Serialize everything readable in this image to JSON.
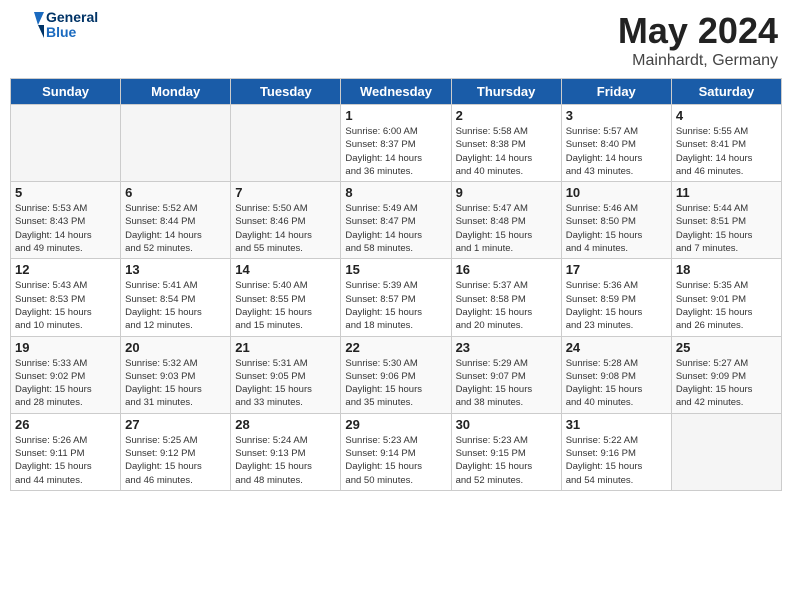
{
  "header": {
    "logo_line1": "General",
    "logo_line2": "Blue",
    "month_year": "May 2024",
    "location": "Mainhardt, Germany"
  },
  "days_of_week": [
    "Sunday",
    "Monday",
    "Tuesday",
    "Wednesday",
    "Thursday",
    "Friday",
    "Saturday"
  ],
  "weeks": [
    [
      {
        "day": "",
        "info": ""
      },
      {
        "day": "",
        "info": ""
      },
      {
        "day": "",
        "info": ""
      },
      {
        "day": "1",
        "info": "Sunrise: 6:00 AM\nSunset: 8:37 PM\nDaylight: 14 hours\nand 36 minutes."
      },
      {
        "day": "2",
        "info": "Sunrise: 5:58 AM\nSunset: 8:38 PM\nDaylight: 14 hours\nand 40 minutes."
      },
      {
        "day": "3",
        "info": "Sunrise: 5:57 AM\nSunset: 8:40 PM\nDaylight: 14 hours\nand 43 minutes."
      },
      {
        "day": "4",
        "info": "Sunrise: 5:55 AM\nSunset: 8:41 PM\nDaylight: 14 hours\nand 46 minutes."
      }
    ],
    [
      {
        "day": "5",
        "info": "Sunrise: 5:53 AM\nSunset: 8:43 PM\nDaylight: 14 hours\nand 49 minutes."
      },
      {
        "day": "6",
        "info": "Sunrise: 5:52 AM\nSunset: 8:44 PM\nDaylight: 14 hours\nand 52 minutes."
      },
      {
        "day": "7",
        "info": "Sunrise: 5:50 AM\nSunset: 8:46 PM\nDaylight: 14 hours\nand 55 minutes."
      },
      {
        "day": "8",
        "info": "Sunrise: 5:49 AM\nSunset: 8:47 PM\nDaylight: 14 hours\nand 58 minutes."
      },
      {
        "day": "9",
        "info": "Sunrise: 5:47 AM\nSunset: 8:48 PM\nDaylight: 15 hours\nand 1 minute."
      },
      {
        "day": "10",
        "info": "Sunrise: 5:46 AM\nSunset: 8:50 PM\nDaylight: 15 hours\nand 4 minutes."
      },
      {
        "day": "11",
        "info": "Sunrise: 5:44 AM\nSunset: 8:51 PM\nDaylight: 15 hours\nand 7 minutes."
      }
    ],
    [
      {
        "day": "12",
        "info": "Sunrise: 5:43 AM\nSunset: 8:53 PM\nDaylight: 15 hours\nand 10 minutes."
      },
      {
        "day": "13",
        "info": "Sunrise: 5:41 AM\nSunset: 8:54 PM\nDaylight: 15 hours\nand 12 minutes."
      },
      {
        "day": "14",
        "info": "Sunrise: 5:40 AM\nSunset: 8:55 PM\nDaylight: 15 hours\nand 15 minutes."
      },
      {
        "day": "15",
        "info": "Sunrise: 5:39 AM\nSunset: 8:57 PM\nDaylight: 15 hours\nand 18 minutes."
      },
      {
        "day": "16",
        "info": "Sunrise: 5:37 AM\nSunset: 8:58 PM\nDaylight: 15 hours\nand 20 minutes."
      },
      {
        "day": "17",
        "info": "Sunrise: 5:36 AM\nSunset: 8:59 PM\nDaylight: 15 hours\nand 23 minutes."
      },
      {
        "day": "18",
        "info": "Sunrise: 5:35 AM\nSunset: 9:01 PM\nDaylight: 15 hours\nand 26 minutes."
      }
    ],
    [
      {
        "day": "19",
        "info": "Sunrise: 5:33 AM\nSunset: 9:02 PM\nDaylight: 15 hours\nand 28 minutes."
      },
      {
        "day": "20",
        "info": "Sunrise: 5:32 AM\nSunset: 9:03 PM\nDaylight: 15 hours\nand 31 minutes."
      },
      {
        "day": "21",
        "info": "Sunrise: 5:31 AM\nSunset: 9:05 PM\nDaylight: 15 hours\nand 33 minutes."
      },
      {
        "day": "22",
        "info": "Sunrise: 5:30 AM\nSunset: 9:06 PM\nDaylight: 15 hours\nand 35 minutes."
      },
      {
        "day": "23",
        "info": "Sunrise: 5:29 AM\nSunset: 9:07 PM\nDaylight: 15 hours\nand 38 minutes."
      },
      {
        "day": "24",
        "info": "Sunrise: 5:28 AM\nSunset: 9:08 PM\nDaylight: 15 hours\nand 40 minutes."
      },
      {
        "day": "25",
        "info": "Sunrise: 5:27 AM\nSunset: 9:09 PM\nDaylight: 15 hours\nand 42 minutes."
      }
    ],
    [
      {
        "day": "26",
        "info": "Sunrise: 5:26 AM\nSunset: 9:11 PM\nDaylight: 15 hours\nand 44 minutes."
      },
      {
        "day": "27",
        "info": "Sunrise: 5:25 AM\nSunset: 9:12 PM\nDaylight: 15 hours\nand 46 minutes."
      },
      {
        "day": "28",
        "info": "Sunrise: 5:24 AM\nSunset: 9:13 PM\nDaylight: 15 hours\nand 48 minutes."
      },
      {
        "day": "29",
        "info": "Sunrise: 5:23 AM\nSunset: 9:14 PM\nDaylight: 15 hours\nand 50 minutes."
      },
      {
        "day": "30",
        "info": "Sunrise: 5:23 AM\nSunset: 9:15 PM\nDaylight: 15 hours\nand 52 minutes."
      },
      {
        "day": "31",
        "info": "Sunrise: 5:22 AM\nSunset: 9:16 PM\nDaylight: 15 hours\nand 54 minutes."
      },
      {
        "day": "",
        "info": ""
      }
    ]
  ]
}
